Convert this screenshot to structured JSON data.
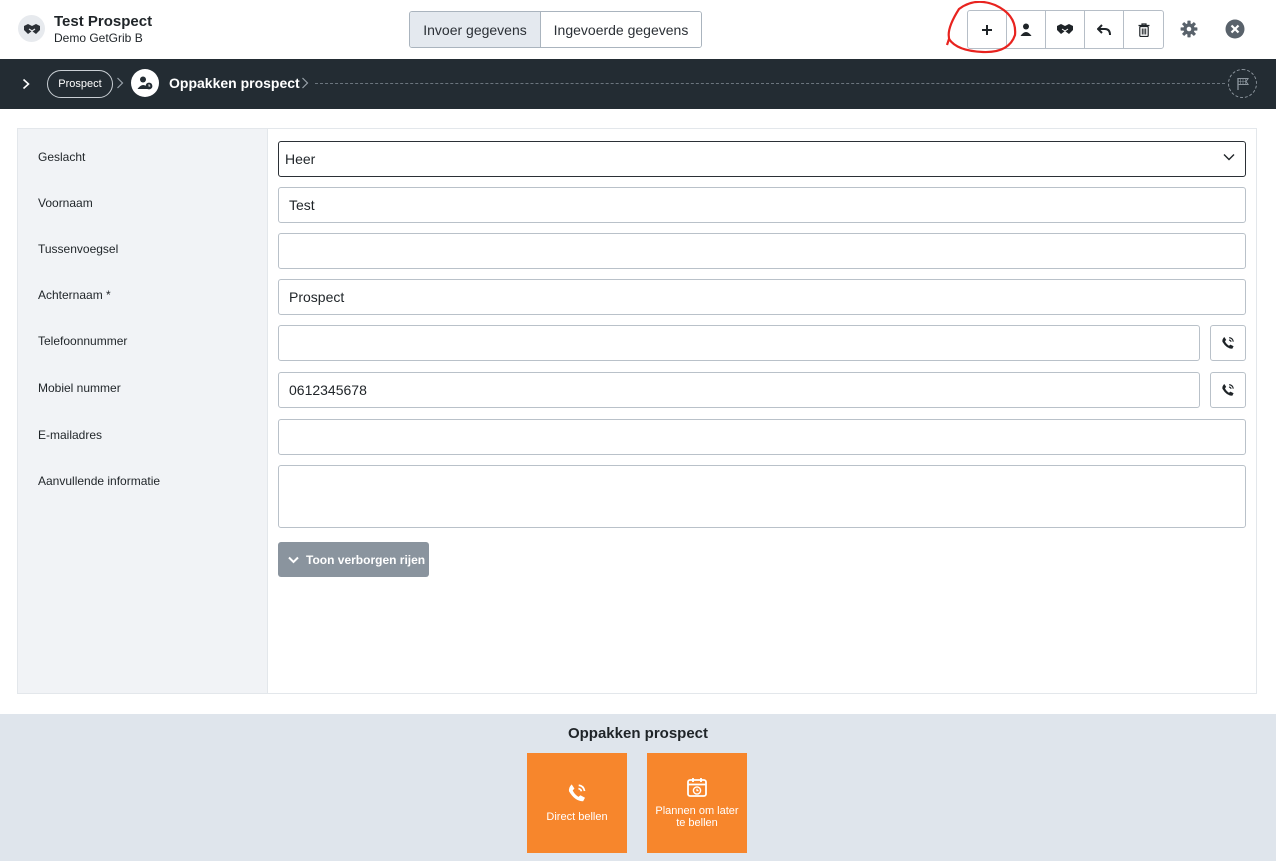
{
  "header": {
    "title": "Test Prospect",
    "subtitle": "Demo GetGrib B",
    "tabs": [
      {
        "label": "Invoer gegevens",
        "active": true
      },
      {
        "label": "Ingevoerde gegevens",
        "active": false
      }
    ],
    "actions": [
      {
        "icon": "plus-icon",
        "highlighted": true
      },
      {
        "icon": "person-icon"
      },
      {
        "icon": "handshake-icon"
      },
      {
        "icon": "reply-icon"
      },
      {
        "icon": "trash-icon"
      }
    ],
    "annotation_color": "#e8231f"
  },
  "breadcrumb": {
    "parent": "Prospect",
    "current": "Oppakken prospect"
  },
  "form": {
    "fields": [
      {
        "label": "Geslacht",
        "value": "Heer",
        "type": "select"
      },
      {
        "label": "Voornaam",
        "value": "Test",
        "type": "text"
      },
      {
        "label": "Tussenvoegsel",
        "value": "",
        "type": "text"
      },
      {
        "label": "Achternaam *",
        "value": "Prospect",
        "type": "text"
      },
      {
        "label": "Telefoonnummer",
        "value": "",
        "type": "phone"
      },
      {
        "label": "Mobiel nummer",
        "value": "0612345678",
        "type": "phone"
      },
      {
        "label": "E-mailadres",
        "value": "",
        "type": "text"
      },
      {
        "label": "Aanvullende informatie",
        "value": "",
        "type": "textarea"
      }
    ],
    "toggle_label": "Toon verborgen rijen"
  },
  "bottom": {
    "title": "Oppakken prospect",
    "buttons": [
      {
        "label": "Direct bellen",
        "icon": "phone-call-icon"
      },
      {
        "label": "Plannen om later te bellen",
        "icon": "calendar-clock-icon"
      }
    ],
    "accent_color": "#f7862c"
  }
}
